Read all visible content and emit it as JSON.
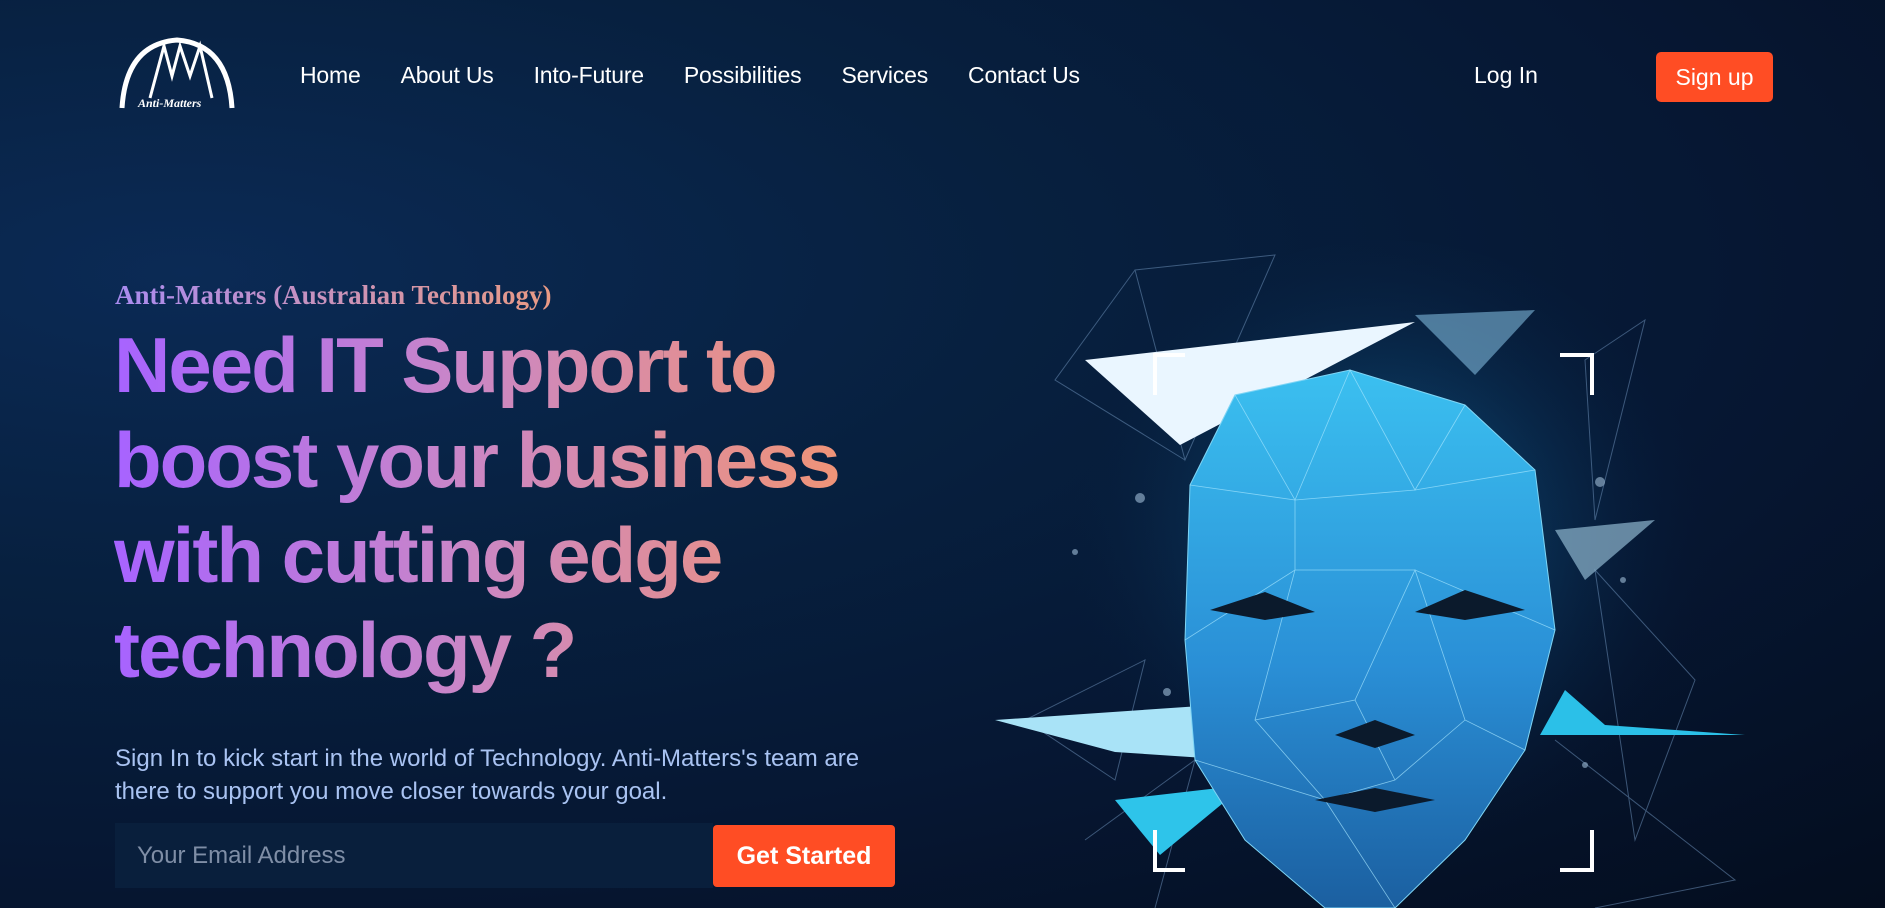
{
  "brand": {
    "logo_text": "Anti-Matters",
    "logo_icon": "am-arch-logo"
  },
  "nav": {
    "items": [
      {
        "label": "Home"
      },
      {
        "label": "About Us"
      },
      {
        "label": "Into-Future"
      },
      {
        "label": "Possibilities"
      },
      {
        "label": "Services"
      },
      {
        "label": "Contact Us"
      }
    ],
    "login_label": "Log In",
    "signup_label": "Sign up"
  },
  "hero": {
    "eyebrow": "Anti-Matters (Australian Technology)",
    "headline": "Need IT Support to boost your business with cutting edge technology ?",
    "description": "Sign In to kick start in the world of Technology. Anti-Matters's team are there to support you move closer towards your goal.",
    "email_placeholder": "Your Email Address",
    "email_value": "",
    "cta_label": "Get Started",
    "illustration": "polygon-face-scan"
  },
  "colors": {
    "accent": "#ff4d24",
    "background": "#061733",
    "gradient_start": "#a763ff",
    "gradient_end": "#f39570"
  }
}
